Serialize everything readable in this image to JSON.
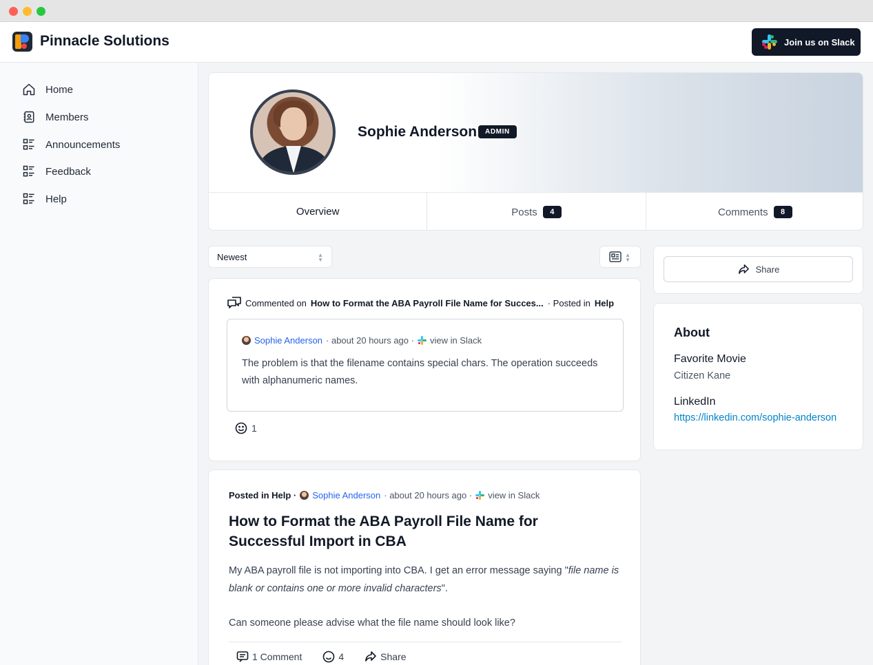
{
  "app": {
    "brand": "Pinnacle Solutions",
    "slack_button": "Join us on Slack"
  },
  "sidebar": {
    "items": [
      {
        "label": "Home",
        "icon": "home-icon"
      },
      {
        "label": "Members",
        "icon": "contacts-icon"
      },
      {
        "label": "Announcements",
        "icon": "list-icon"
      },
      {
        "label": "Feedback",
        "icon": "list-icon"
      },
      {
        "label": "Help",
        "icon": "list-icon"
      }
    ]
  },
  "profile": {
    "name": "Sophie Anderson",
    "role_badge": "ADMIN",
    "tabs": [
      {
        "label": "Overview",
        "count": null,
        "active": true
      },
      {
        "label": "Posts",
        "count": "4"
      },
      {
        "label": "Comments",
        "count": "8"
      }
    ]
  },
  "feed": {
    "sort": "Newest",
    "activity": {
      "prefix": "Commented on",
      "post_title": "How to Format the ABA Payroll File Name for Succes...",
      "posted_in_label": "· Posted in",
      "channel": "Help",
      "author": "Sophie Anderson",
      "time": "· about 20 hours ago ·",
      "slack_link": "view in Slack",
      "comment": "The problem is that the filename contains special chars. The operation succeeds with alphanumeric names.",
      "reaction_count": "1"
    },
    "post": {
      "posted_in_label": "Posted in Help ·",
      "author": "Sophie Anderson",
      "time": "· about 20 hours ago ·",
      "slack_link": "view in Slack",
      "title": "How to Format the ABA Payroll File Name for Successful Import in CBA",
      "body_before": "My ABA payroll file is not importing into CBA. I get an error message saying \"",
      "body_quote": "file name is blank or contains one or more invalid characters",
      "body_after": "\".",
      "body_2": "Can someone please advise what the file name should look like?",
      "comments_label": "1 Comment",
      "reaction_count": "4",
      "share_label": "Share"
    }
  },
  "right": {
    "share_label": "Share",
    "about_title": "About",
    "fields": [
      {
        "label": "Favorite Movie",
        "value": "Citizen Kane"
      },
      {
        "label": "LinkedIn",
        "value": "https://linkedin.com/sophie-anderson"
      }
    ]
  },
  "colors": {
    "accent_dark": "#111827",
    "link": "#2563eb",
    "linkedin_link": "#0284c7",
    "tab_underline": "#93c5fd"
  }
}
